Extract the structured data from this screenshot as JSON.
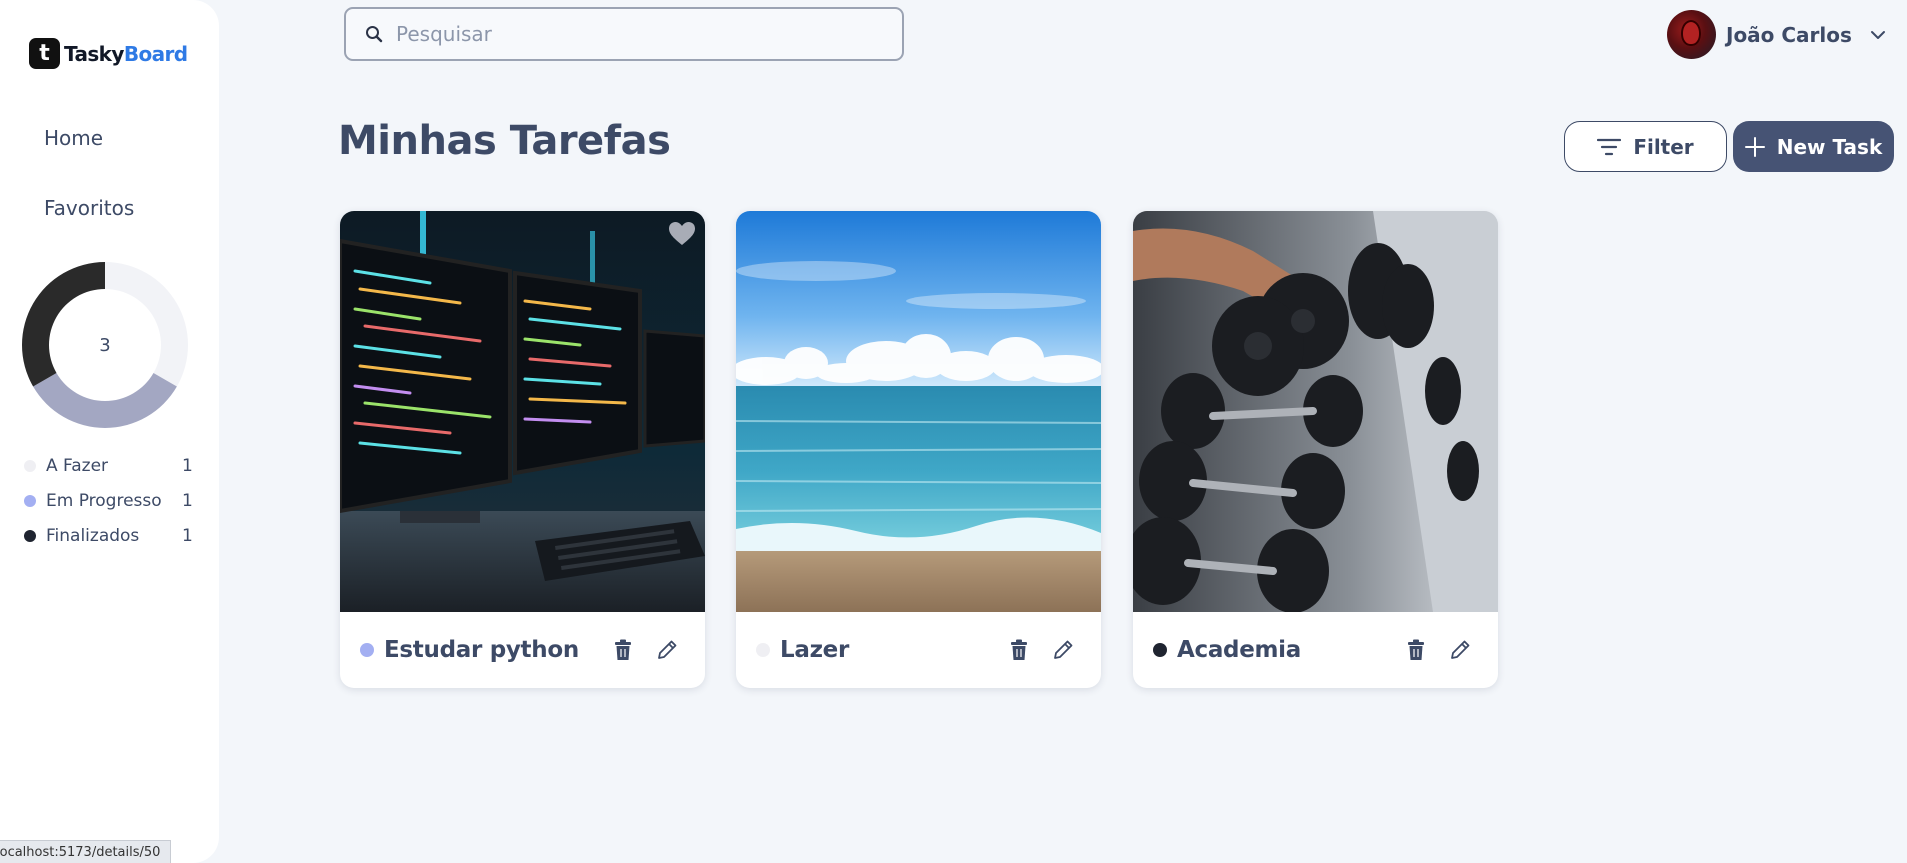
{
  "brand": {
    "prefix": "Tasky",
    "suffix": "Board",
    "mark": "t",
    "suffix_color": "#2f7ae5"
  },
  "nav": [
    {
      "label": "Home"
    },
    {
      "label": "Favoritos"
    }
  ],
  "stats": {
    "total": "3",
    "items": [
      {
        "label": "A Fazer",
        "count": "1",
        "color": "#efeff3"
      },
      {
        "label": "Em Progresso",
        "count": "1",
        "color": "#a3aff2"
      },
      {
        "label": "Finalizados",
        "count": "1",
        "color": "#1f2430"
      }
    ]
  },
  "chart_data": {
    "type": "pie",
    "center_label": "3",
    "categories": [
      "A Fazer",
      "Em Progresso",
      "Finalizados"
    ],
    "values": [
      1,
      1,
      1
    ],
    "colors": [
      "#f2f3f7",
      "#a3a7c2",
      "#2a2a2a"
    ]
  },
  "search": {
    "placeholder": "Pesquisar",
    "value": ""
  },
  "user": {
    "name": "João Carlos"
  },
  "page": {
    "title": "Minhas Tarefas"
  },
  "actions": {
    "filter_label": "Filter",
    "new_task_label": "New Task"
  },
  "tasks": [
    {
      "title": "Estudar python",
      "status_color": "#a3aff2",
      "image": "computer-monitors-code",
      "favorite": true
    },
    {
      "title": "Lazer",
      "status_color": "#efeff3",
      "image": "beach-ocean",
      "favorite": false
    },
    {
      "title": "Academia",
      "status_color": "#1f2430",
      "image": "gym-dumbbells",
      "favorite": false
    }
  ],
  "status_bar": {
    "url": "localhost:5173/details/50"
  },
  "colors": {
    "primary": "#465374",
    "text": "#3d4a66",
    "background": "#f3f6fa"
  }
}
